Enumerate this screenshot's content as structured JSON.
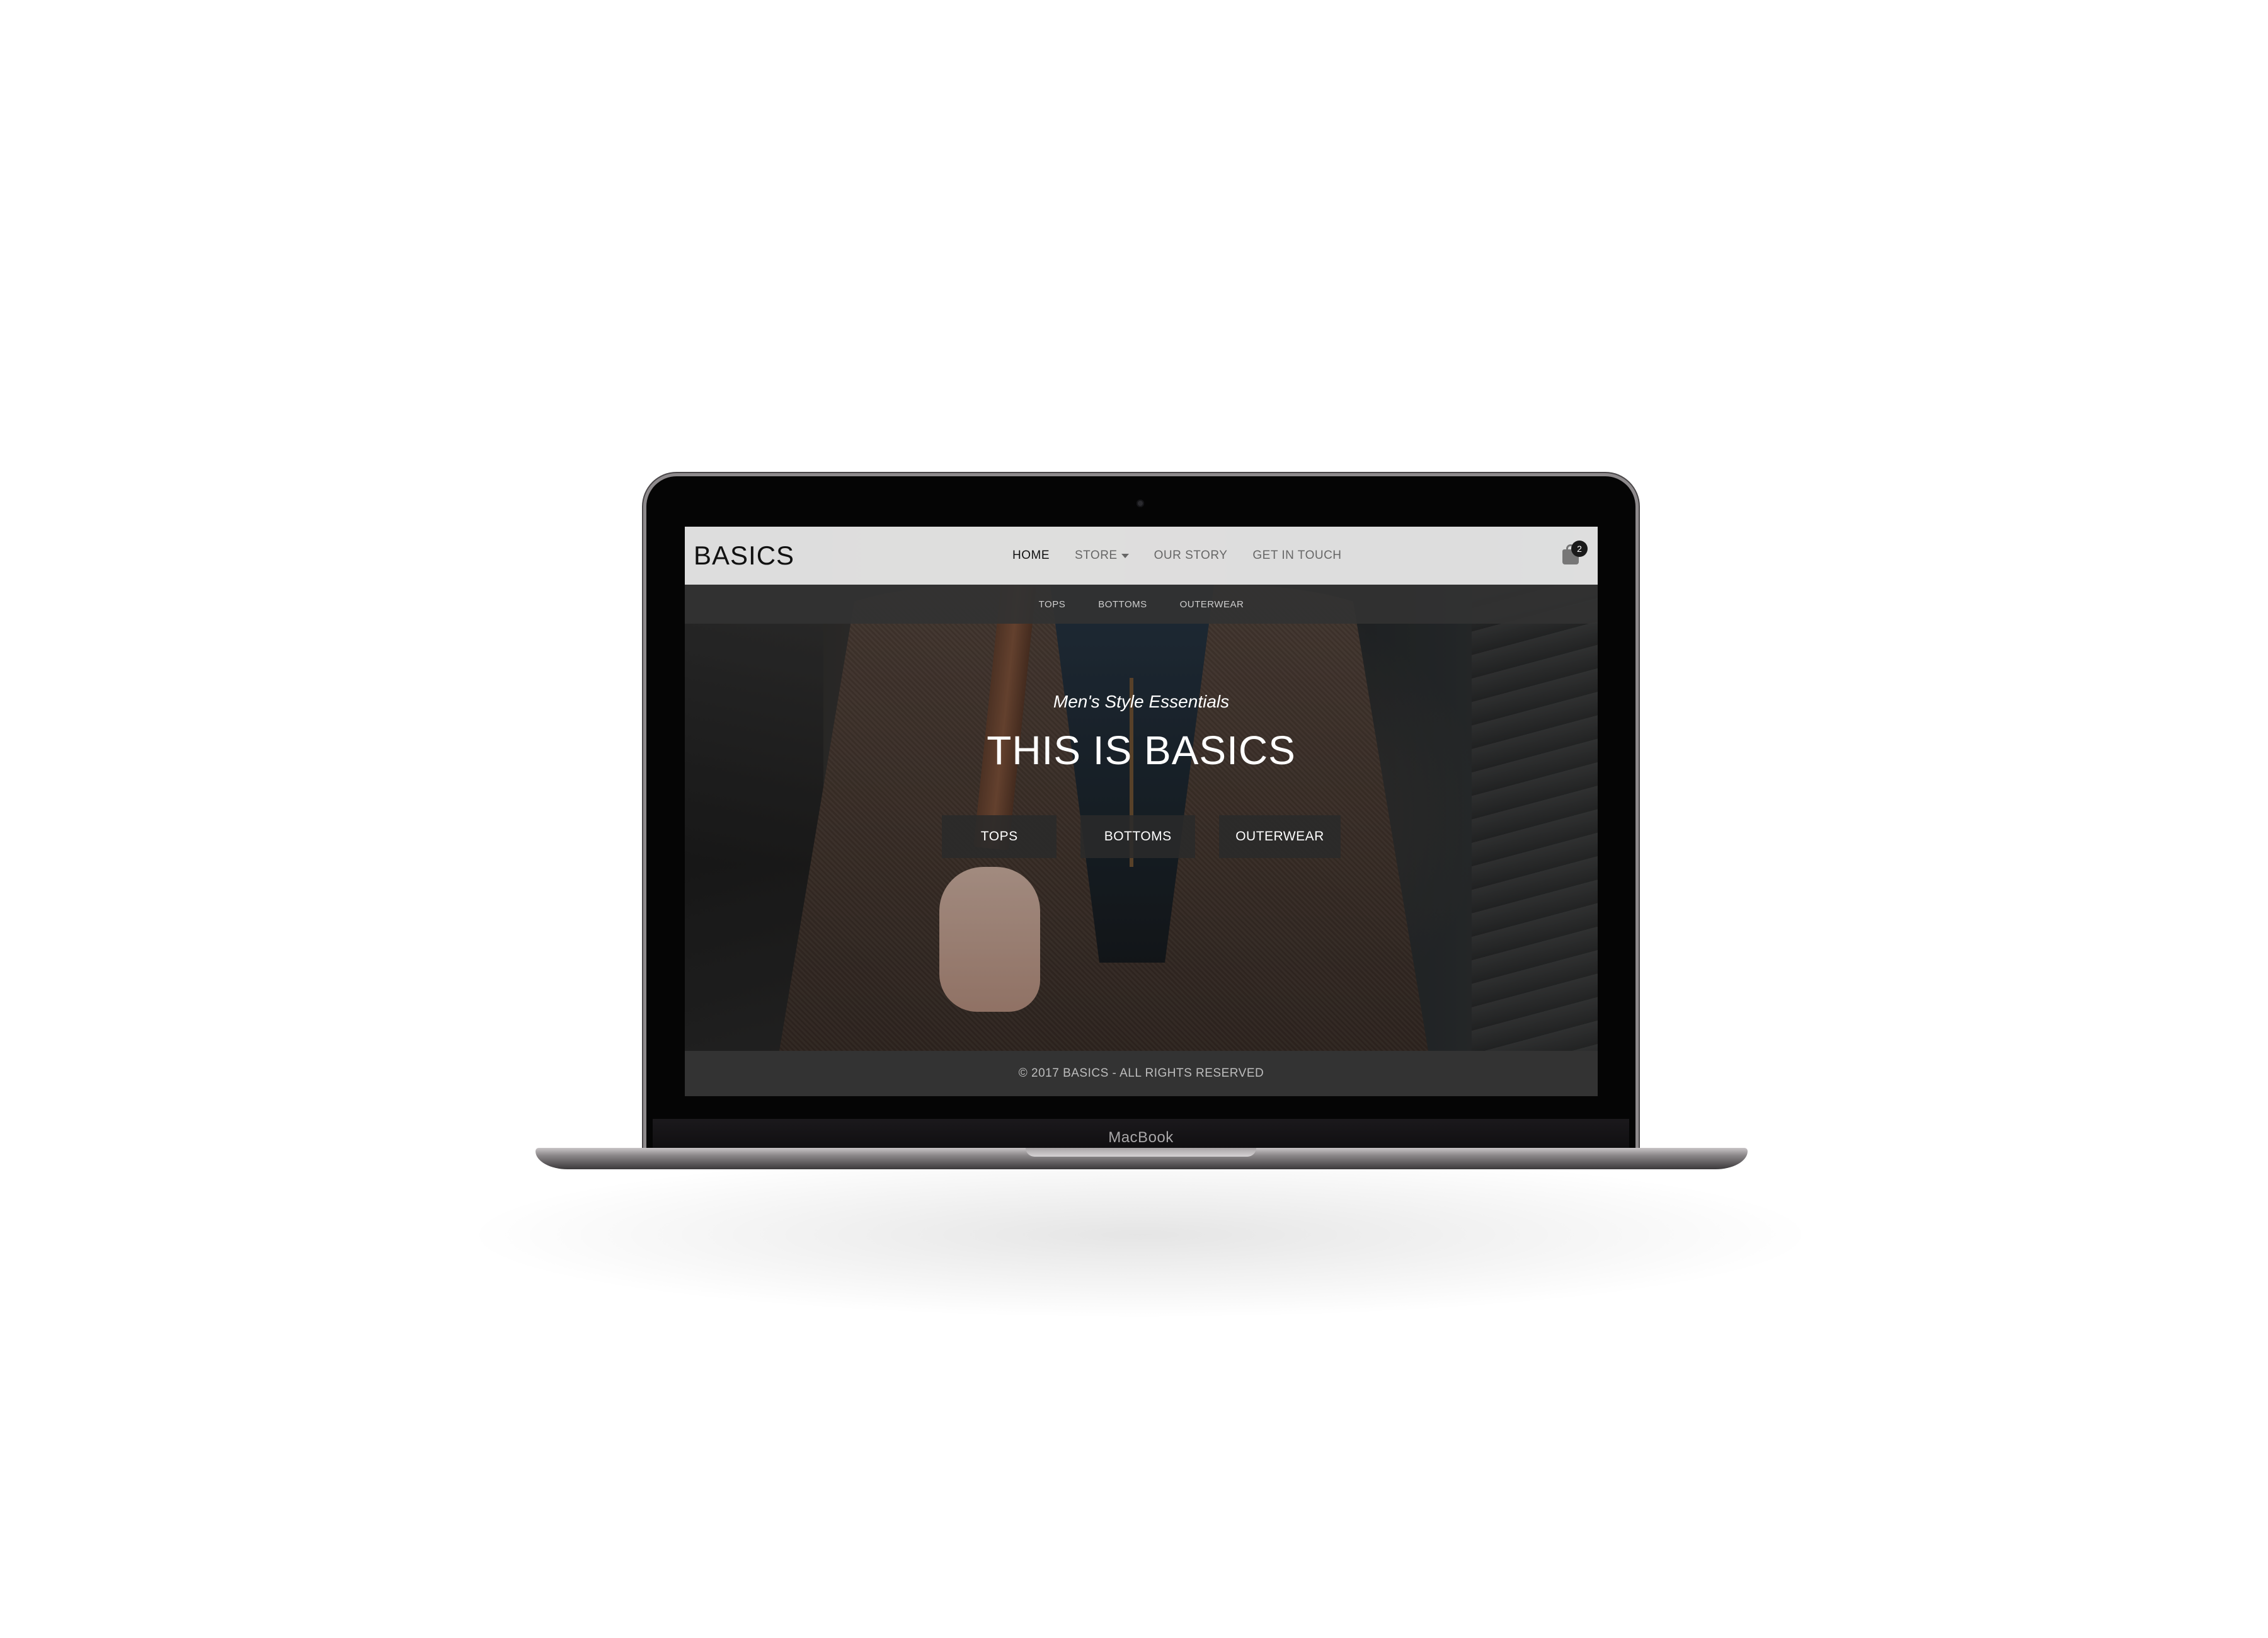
{
  "device": {
    "chin_label": "MacBook"
  },
  "site": {
    "brand": "BASICS",
    "nav": [
      {
        "label": "HOME",
        "active": true
      },
      {
        "label": "STORE",
        "dropdown": true
      },
      {
        "label": "OUR STORY"
      },
      {
        "label": "GET IN TOUCH"
      }
    ],
    "cart_count": "2",
    "subnav": [
      "TOPS",
      "BOTTOMS",
      "OUTERWEAR"
    ],
    "hero": {
      "tagline": "Men's Style Essentials",
      "headline": "THIS IS BASICS",
      "buttons": [
        "TOPS",
        "BOTTOMS",
        "OUTERWEAR"
      ]
    },
    "footer": "© 2017 BASICS - ALL RIGHTS RESERVED"
  },
  "icons": {
    "cart": "shopping-bag-icon",
    "store_caret": "caret-down-icon"
  },
  "colors": {
    "nav_bg": "#ececec",
    "subnav_bg": "#323232",
    "footer_bg": "#333333",
    "button_bg": "#2a2a2a"
  }
}
